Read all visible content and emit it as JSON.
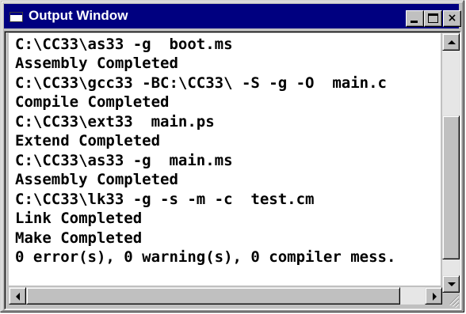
{
  "window": {
    "title": "Output Window",
    "title_bar_color": "#000080"
  },
  "titlebar_buttons": {
    "minimize_icon": "minimize-icon",
    "maximize_icon": "maximize-icon",
    "close_icon": "close-icon",
    "close_glyph": "×"
  },
  "output": {
    "lines": [
      "C:\\CC33\\as33 -g  boot.ms",
      "Assembly Completed",
      "C:\\CC33\\gcc33 -BC:\\CC33\\ -S -g -O  main.c",
      "Compile Completed",
      "C:\\CC33\\ext33  main.ps",
      "Extend Completed",
      "C:\\CC33\\as33 -g  main.ms",
      "Assembly Completed",
      "C:\\CC33\\lk33 -g -s -m -c  test.cm",
      "Link Completed",
      "Make Completed",
      "0 error(s), 0 warning(s), 0 compiler mess."
    ]
  },
  "scrollbars": {
    "vertical": {
      "up_icon": "arrow-up-icon",
      "down_icon": "arrow-down-icon"
    },
    "horizontal": {
      "left_icon": "arrow-left-icon",
      "right_icon": "arrow-right-icon"
    },
    "resize_grip_icon": "resize-grip-icon"
  }
}
